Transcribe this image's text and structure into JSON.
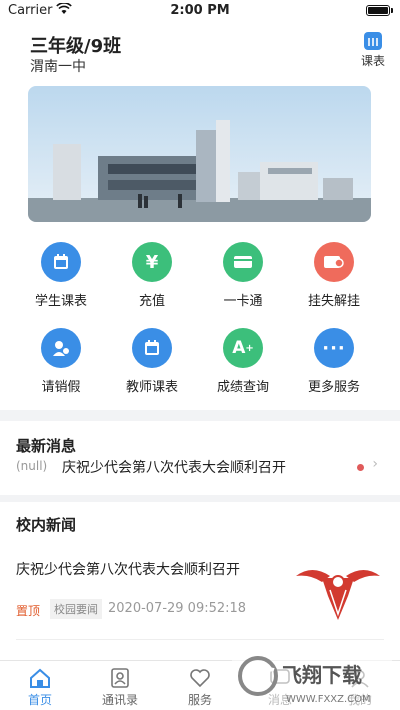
{
  "status_bar": {
    "carrier": "Carrier",
    "time": "2:00 PM"
  },
  "header": {
    "class_title": "三年级/9班",
    "school": "渭南一中",
    "schedule_label": "课表"
  },
  "grid": [
    {
      "label": "学生课表",
      "icon": "calendar-icon",
      "color": "#3a8ee6"
    },
    {
      "label": "充值",
      "icon": "yen-icon",
      "color": "#3cbf7b"
    },
    {
      "label": "一卡通",
      "icon": "card-icon",
      "color": "#3cbf7b"
    },
    {
      "label": "挂失解挂",
      "icon": "card-lock-icon",
      "color": "#ef6b5c"
    },
    {
      "label": "请销假",
      "icon": "leave-icon",
      "color": "#3a8ee6"
    },
    {
      "label": "教师课表",
      "icon": "calendar-icon",
      "color": "#3a8ee6"
    },
    {
      "label": "成绩查询",
      "icon": "grade-icon",
      "color": "#3cbf7b"
    },
    {
      "label": "更多服务",
      "icon": "more-icon",
      "color": "#3a8ee6"
    }
  ],
  "latest": {
    "title": "最新消息",
    "tag": "(null)",
    "headline": "庆祝少代会第八次代表大会顺利召开"
  },
  "campus_news": {
    "title": "校内新闻",
    "article_title": "庆祝少代会第八次代表大会顺利召开",
    "pin_label": "置顶",
    "category": "校园要闻",
    "date": "2020-07-29 09:52:18"
  },
  "tabbar": [
    {
      "label": "首页",
      "icon": "home-icon",
      "active": true
    },
    {
      "label": "通讯录",
      "icon": "contacts-icon",
      "active": false
    },
    {
      "label": "服务",
      "icon": "heart-icon",
      "active": false
    },
    {
      "label": "消息",
      "icon": "message-icon",
      "active": false
    },
    {
      "label": "我的",
      "icon": "profile-icon",
      "active": false
    }
  ],
  "watermark": {
    "text": "飞翔下载",
    "url": "WWW.FXXZ.COM"
  },
  "colors": {
    "accent": "#3a8ee6",
    "green": "#3cbf7b",
    "red": "#ef6b5c"
  }
}
